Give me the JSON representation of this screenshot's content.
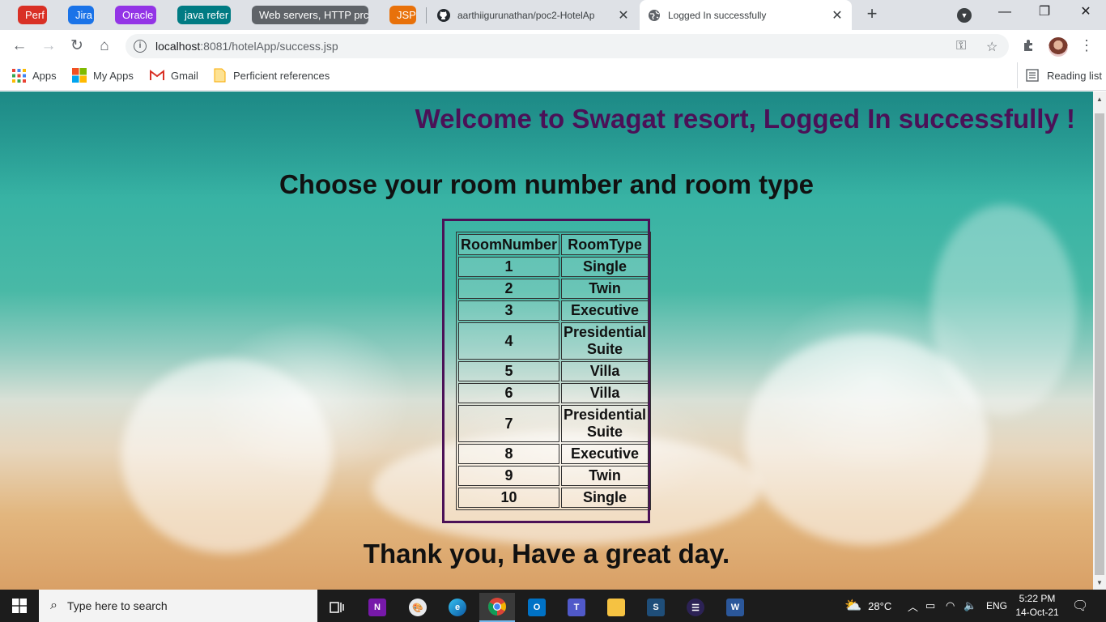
{
  "browser": {
    "tab_groups": [
      {
        "label": "Perf",
        "color": "#d93025"
      },
      {
        "label": "Jira",
        "color": "#1a73e8"
      },
      {
        "label": "Oracle",
        "color": "#9334e6"
      },
      {
        "label": "java refer",
        "color": "#007b83"
      },
      {
        "label": "Web servers, HTTP prc",
        "color": "#5f6368"
      },
      {
        "label": "JSP",
        "color": "#e8710a"
      }
    ],
    "tabs": [
      {
        "title": "aarthiigurunathan/poc2-HotelAp",
        "icon": "github-icon"
      },
      {
        "title": "Logged In successfully",
        "icon": "globe-icon"
      }
    ],
    "url": {
      "host": "localhost",
      "port_path": ":8081/hotelApp/success.jsp"
    },
    "bookmarks": [
      {
        "label": "Apps",
        "icon": "apps-grid-icon"
      },
      {
        "label": "My Apps",
        "icon": "microsoft-icon"
      },
      {
        "label": "Gmail",
        "icon": "gmail-icon"
      },
      {
        "label": "Perficient references",
        "icon": "folder-icon"
      }
    ],
    "reading_list": "Reading list"
  },
  "page": {
    "welcome": "Welcome to Swagat resort, Logged In successfully !",
    "choose": "Choose your room number and room type",
    "table": {
      "headers": [
        "RoomNumber",
        "RoomType"
      ],
      "rows": [
        {
          "number": "1",
          "type": "Single"
        },
        {
          "number": "2",
          "type": "Twin"
        },
        {
          "number": "3",
          "type": "Executive"
        },
        {
          "number": "4",
          "type": "Presidential Suite"
        },
        {
          "number": "5",
          "type": "Villa"
        },
        {
          "number": "6",
          "type": "Villa"
        },
        {
          "number": "7",
          "type": "Presidential Suite"
        },
        {
          "number": "8",
          "type": "Executive"
        },
        {
          "number": "9",
          "type": "Twin"
        },
        {
          "number": "10",
          "type": "Single"
        }
      ]
    },
    "thanks": "Thank you, Have a great day.",
    "accent_color": "#4b1157"
  },
  "taskbar": {
    "search_placeholder": "Type here to search",
    "weather": "28°C",
    "language": "ENG",
    "time": "5:22 PM",
    "date": "14-Oct-21"
  }
}
